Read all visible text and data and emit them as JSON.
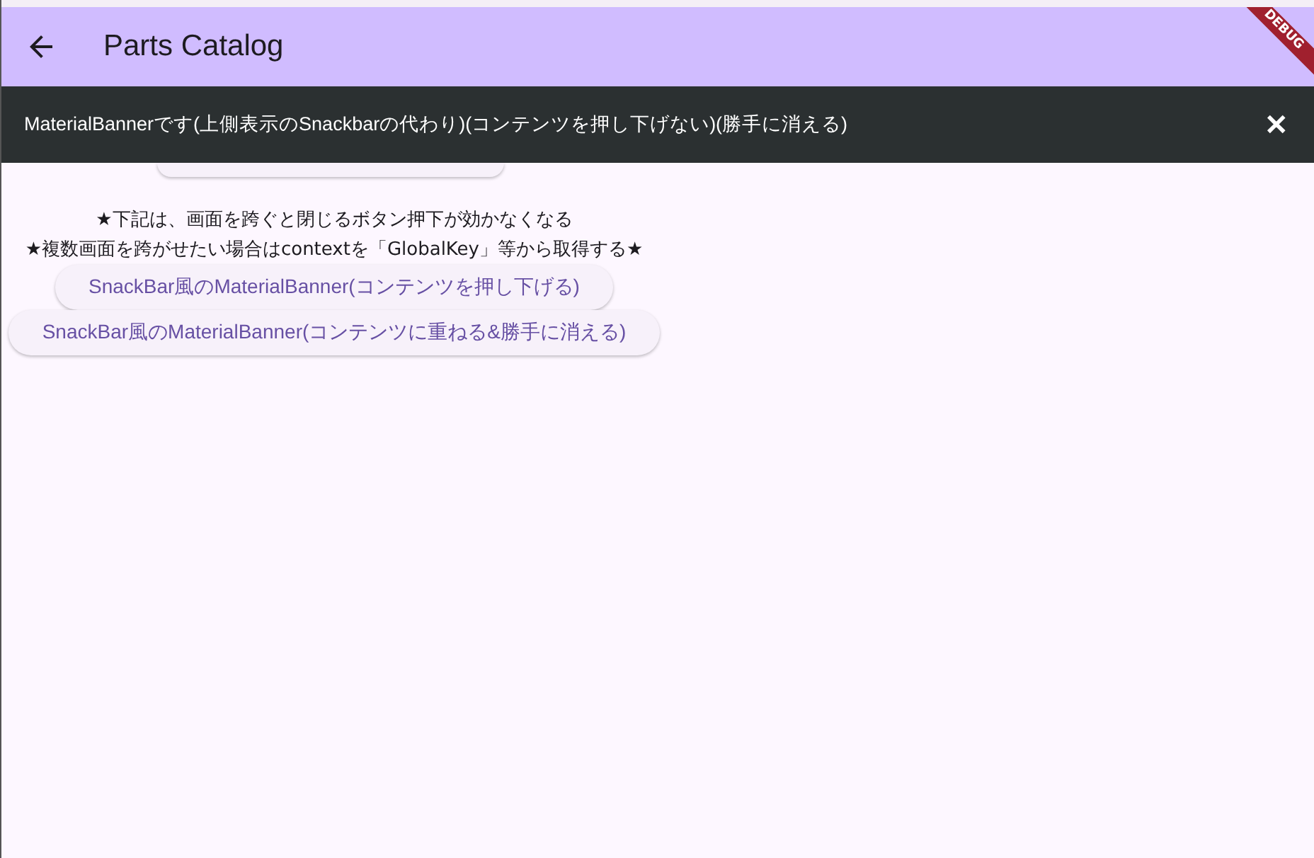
{
  "app_bar": {
    "title": "Parts Catalog",
    "debug_label": "DEBUG"
  },
  "banner": {
    "message": "MaterialBannerです(上側表示のSnackbarの代わり)(コンテンツを押し下げない)(勝手に消える)",
    "close_icon": "✕"
  },
  "notes": [
    "★下記は、画面を跨ぐと閉じるボタン押下が効かなくなる",
    "★複数画面を跨がせたい場合はcontextを「GlobalKey」等から取得する★"
  ],
  "buttons": [
    "SnackBar風のMaterialBanner(コンテンツを押し下げる)",
    "SnackBar風のMaterialBanner(コンテンツに重ねる&勝手に消える)"
  ]
}
